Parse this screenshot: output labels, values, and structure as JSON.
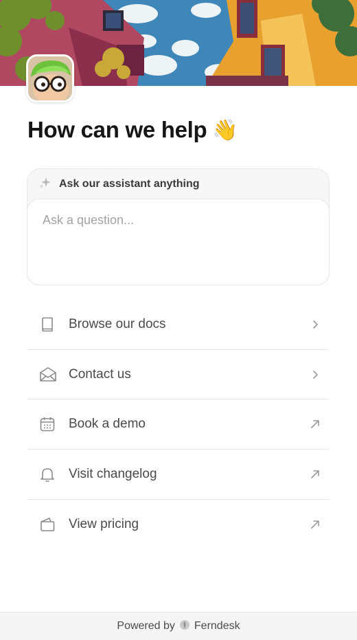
{
  "header": {
    "banner_image": "pixel-art-courtyard-sky",
    "avatar": "cartoon-character-green-hair-glasses"
  },
  "hero": {
    "title": "How can we help",
    "emoji": "👋"
  },
  "assistant": {
    "icon": "sparkle-icon",
    "label": "Ask our assistant anything",
    "placeholder": "Ask a question..."
  },
  "links": [
    {
      "label": "Browse our docs",
      "icon": "book-icon",
      "arrow": "chevron-right"
    },
    {
      "label": "Contact us",
      "icon": "envelope-icon",
      "arrow": "chevron-right"
    },
    {
      "label": "Book a demo",
      "icon": "calendar-icon",
      "arrow": "external-arrow"
    },
    {
      "label": "Visit changelog",
      "icon": "bell-icon",
      "arrow": "external-arrow"
    },
    {
      "label": "View pricing",
      "icon": "wallet-icon",
      "arrow": "external-arrow"
    }
  ],
  "footer": {
    "powered_by": "Powered by",
    "brand": "Ferndesk"
  },
  "colors": {
    "text_primary": "#161616",
    "text_secondary": "#4a4a4a",
    "icon_gray": "#8a8a8a",
    "divider": "#e4e4e4",
    "footer_bg": "#f5f5f5"
  }
}
